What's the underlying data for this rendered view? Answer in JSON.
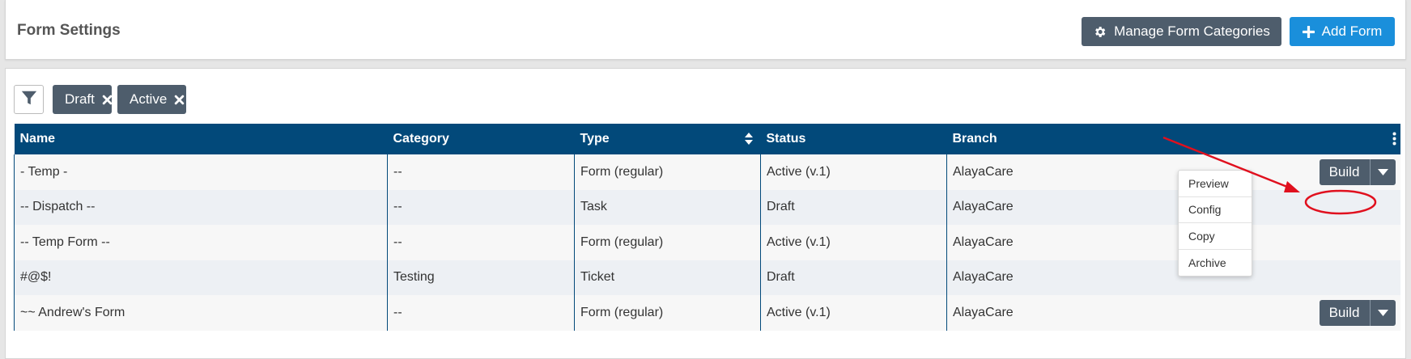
{
  "header": {
    "title": "Form Settings",
    "manage_label": "Manage Form Categories",
    "add_label": "Add Form"
  },
  "filters": [
    {
      "label": "Draft"
    },
    {
      "label": "Active"
    }
  ],
  "table": {
    "columns": [
      "Name",
      "Category",
      "Type",
      "Status",
      "Branch"
    ],
    "rows": [
      {
        "name": "- Temp -",
        "category": "--",
        "type": "Form (regular)",
        "status": "Active (v.1)",
        "branch": "AlayaCare"
      },
      {
        "name": "-- Dispatch --",
        "category": "--",
        "type": "Task",
        "status": "Draft",
        "branch": "AlayaCare"
      },
      {
        "name": "-- Temp Form --",
        "category": "--",
        "type": "Form (regular)",
        "status": "Active (v.1)",
        "branch": "AlayaCare"
      },
      {
        "name": "#@$!",
        "category": "Testing",
        "type": "Ticket",
        "status": "Draft",
        "branch": "AlayaCare"
      },
      {
        "name": "~~ Andrew's Form",
        "category": "--",
        "type": "Form (regular)",
        "status": "Active (v.1)",
        "branch": "AlayaCare"
      }
    ],
    "build_label": "Build"
  },
  "dropdown": {
    "items": [
      "Preview",
      "Config",
      "Copy",
      "Archive"
    ]
  },
  "colors": {
    "header_bg": "#02497a",
    "primary_btn": "#1a8fdb",
    "dark_btn": "#4e5d6c",
    "annotation": "#e0101e"
  },
  "icons": {
    "manage": "gear-icon",
    "add": "plus-icon",
    "filter": "funnel-icon",
    "chip_remove": "close-icon",
    "sort": "sort-icon",
    "menu": "kebab-icon",
    "split": "caret-down-icon"
  }
}
